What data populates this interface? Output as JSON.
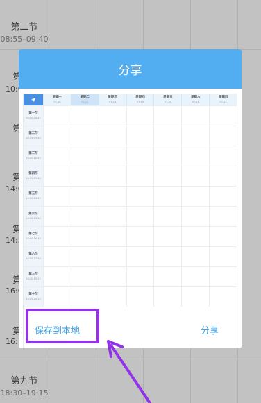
{
  "background": {
    "periods": [
      {
        "name": "第二节",
        "time": "08:55–09:40"
      },
      {
        "name": "第九节",
        "time": "18:30–19:15"
      }
    ],
    "peek_labels": [
      "第",
      "10:0",
      "第",
      "第",
      "14:0",
      "第",
      "14:5",
      "第",
      "16:0",
      "第",
      "16:"
    ]
  },
  "dialog": {
    "title": "分享",
    "preview": {
      "corner_icon": "send-icon",
      "days": [
        {
          "label": "星期一",
          "date": "07-16"
        },
        {
          "label": "星期二",
          "date": "07-17"
        },
        {
          "label": "星期三",
          "date": "07-18"
        },
        {
          "label": "星期四",
          "date": "07-19"
        },
        {
          "label": "星期五",
          "date": "07-20"
        },
        {
          "label": "星期六",
          "date": "07-21"
        },
        {
          "label": "星期日",
          "date": "07-22"
        }
      ],
      "periods": [
        {
          "name": "第一节",
          "time": "08:00-08:45"
        },
        {
          "name": "第二节",
          "time": "08:55-09:40"
        },
        {
          "name": "第三节",
          "time": "10:00-10:45"
        },
        {
          "name": "第四节",
          "time": "10:55-11:40"
        },
        {
          "name": "第五节",
          "time": "14:00-14:45"
        },
        {
          "name": "第六节",
          "time": "14:55-15:40"
        },
        {
          "name": "第七节",
          "time": "16:00-16:45"
        },
        {
          "name": "第八节",
          "time": "16:55-17:40"
        },
        {
          "name": "第九节",
          "time": "18:30-19:15"
        },
        {
          "name": "第十节",
          "time": "19:25-20:10"
        }
      ]
    },
    "save_label": "保存到本地",
    "share_label": "分享"
  },
  "colors": {
    "header": "#52aef0",
    "button_text": "#3aa0e6",
    "highlight": "#9333e8"
  }
}
